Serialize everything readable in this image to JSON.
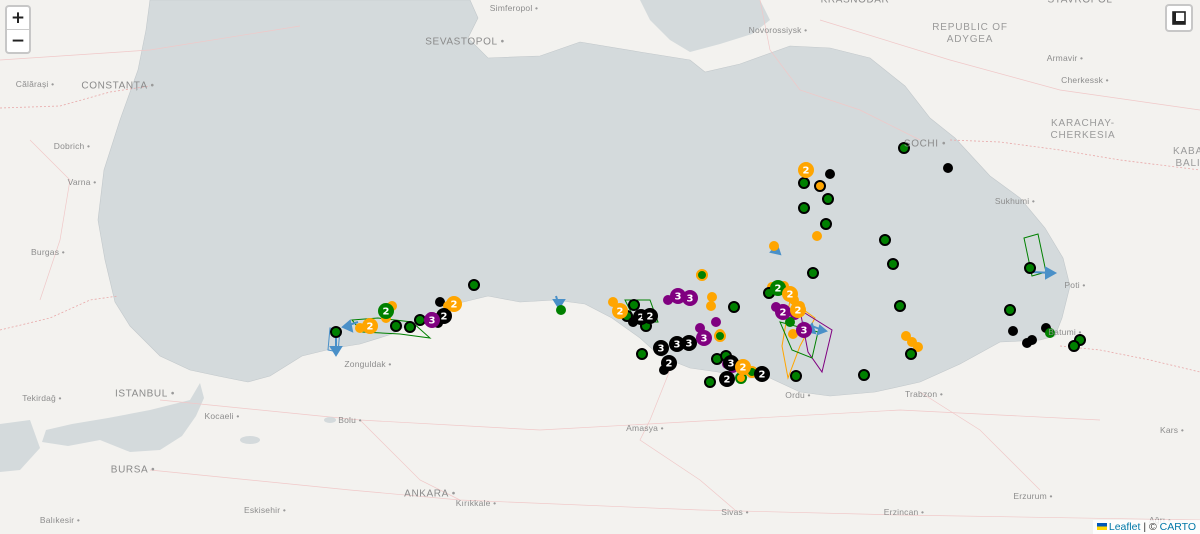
{
  "map": {
    "colors": {
      "sea": "#d4dadc",
      "land": "#f3f2ef",
      "orange": "#ffa500",
      "green": "#008000",
      "black": "#000000",
      "purple": "#800080",
      "arrow": "#4a90c8"
    },
    "labels": [
      {
        "text": "Simferopol",
        "dot": true
      },
      {
        "text": "SEVASTOPOL",
        "dot": true
      },
      {
        "text": "Novorossiysk",
        "dot": true
      },
      {
        "text": "KRASNODAR",
        "dot": false
      },
      {
        "text": "STAVROPOL",
        "dot": false
      },
      {
        "text": "Armavir",
        "dot": true
      },
      {
        "text": "Cherkessk",
        "dot": true
      },
      {
        "text": "Călărași",
        "dot": true
      },
      {
        "text": "CONSTANȚA",
        "dot": true
      },
      {
        "text": "Dobrich",
        "dot": true
      },
      {
        "text": "Varna",
        "dot": true
      },
      {
        "text": "Burgas",
        "dot": true
      },
      {
        "text": "SOCHI",
        "dot": true
      },
      {
        "text": "Sukhumi",
        "dot": true
      },
      {
        "text": "Poti",
        "dot": true
      },
      {
        "text": "Batumi",
        "dot": true
      },
      {
        "text": "Zonguldak",
        "dot": true
      },
      {
        "text": "Tekirdağ",
        "dot": true
      },
      {
        "text": "ISTANBUL",
        "dot": true
      },
      {
        "text": "Kocaeli",
        "dot": true
      },
      {
        "text": "Bolu",
        "dot": true
      },
      {
        "text": "Amasya",
        "dot": true
      },
      {
        "text": "Ordu",
        "dot": true
      },
      {
        "text": "Trabzon",
        "dot": true
      },
      {
        "text": "Kars",
        "dot": true
      },
      {
        "text": "BURSA",
        "dot": true
      },
      {
        "text": "ANKARA",
        "dot": true
      },
      {
        "text": "Kırıkkale",
        "dot": true
      },
      {
        "text": "Eskisehir",
        "dot": true
      },
      {
        "text": "Balıkesir",
        "dot": true
      },
      {
        "text": "Sivas",
        "dot": true
      },
      {
        "text": "Erzincan",
        "dot": true
      },
      {
        "text": "Erzurum",
        "dot": true
      },
      {
        "text": "Ağrı",
        "dot": true
      }
    ],
    "regions": [
      {
        "text": "REPUBLIC OF\nADYGEA"
      },
      {
        "text": "KARACHAY-\nCHERKESIA"
      },
      {
        "text": "KABA\nBALI"
      }
    ]
  },
  "controls": {
    "zoom_in": "+",
    "zoom_out": "−",
    "layers_icon": "layers-icon"
  },
  "attribution": {
    "leaflet": "Leaflet",
    "separator": " | © ",
    "carto": "CARTO"
  },
  "markers": [
    {
      "color": "orange",
      "count": "2"
    },
    {
      "color": "green",
      "count": "2"
    },
    {
      "color": "black",
      "count": "2"
    },
    {
      "color": "purple",
      "count": "3"
    },
    {
      "color": "orange",
      "count": "2"
    },
    {
      "color": "black",
      "count": "2"
    },
    {
      "color": "purple",
      "count": "3"
    },
    {
      "color": "black",
      "count": "3"
    },
    {
      "color": "purple",
      "count": "3"
    },
    {
      "color": "black",
      "count": "3"
    },
    {
      "color": "black",
      "count": "3"
    },
    {
      "color": "black",
      "count": "2"
    },
    {
      "color": "black",
      "count": "2"
    },
    {
      "color": "black",
      "count": "3"
    },
    {
      "color": "black",
      "count": "2"
    },
    {
      "color": "orange",
      "count": "2"
    },
    {
      "color": "green",
      "count": "2"
    },
    {
      "color": "orange",
      "count": "2"
    },
    {
      "color": "purple",
      "count": "2"
    },
    {
      "color": "purple",
      "count": "3"
    },
    {
      "color": "orange",
      "count": "2"
    },
    {
      "color": "orange",
      "count": "2"
    },
    {
      "color": "black",
      "count": "2"
    },
    {
      "color": "purple",
      "count": "3"
    },
    {
      "color": "orange",
      "count": "2"
    }
  ]
}
